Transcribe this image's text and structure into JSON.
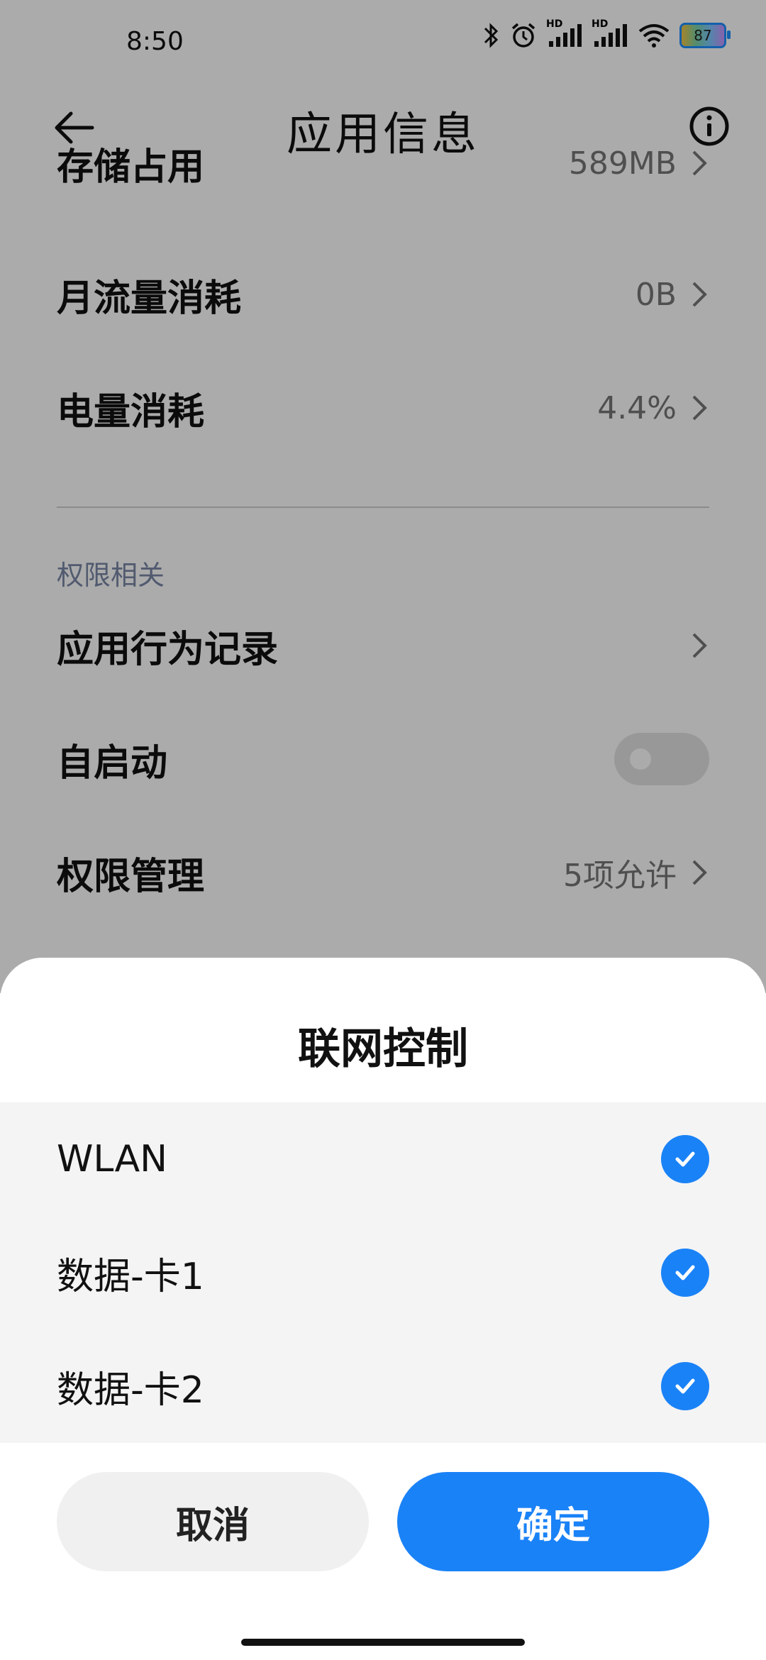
{
  "status_bar": {
    "time": "8:50",
    "signal_label_1": "HD",
    "signal_label_2": "HD",
    "battery": "87"
  },
  "header": {
    "title": "应用信息"
  },
  "rows": {
    "storage": {
      "label": "存储占用",
      "value": "589MB"
    },
    "data_usage": {
      "label": "月流量消耗",
      "value": "0B"
    },
    "battery": {
      "label": "电量消耗",
      "value": "4.4%"
    }
  },
  "permissions_section": {
    "title": "权限相关",
    "behavior_record": "应用行为记录",
    "autostart": "自启动",
    "autostart_on": false,
    "permission_mgmt": {
      "label": "权限管理",
      "value": "5项允许"
    }
  },
  "sheet": {
    "title": "联网控制",
    "options": [
      {
        "label": "WLAN",
        "checked": true
      },
      {
        "label": "数据-卡1",
        "checked": true
      },
      {
        "label": "数据-卡2",
        "checked": true
      }
    ],
    "cancel": "取消",
    "confirm": "确定"
  },
  "colors": {
    "accent": "#1a82f7",
    "section": "#7a86a6",
    "scrim": "rgba(0,0,0,0.33)"
  }
}
